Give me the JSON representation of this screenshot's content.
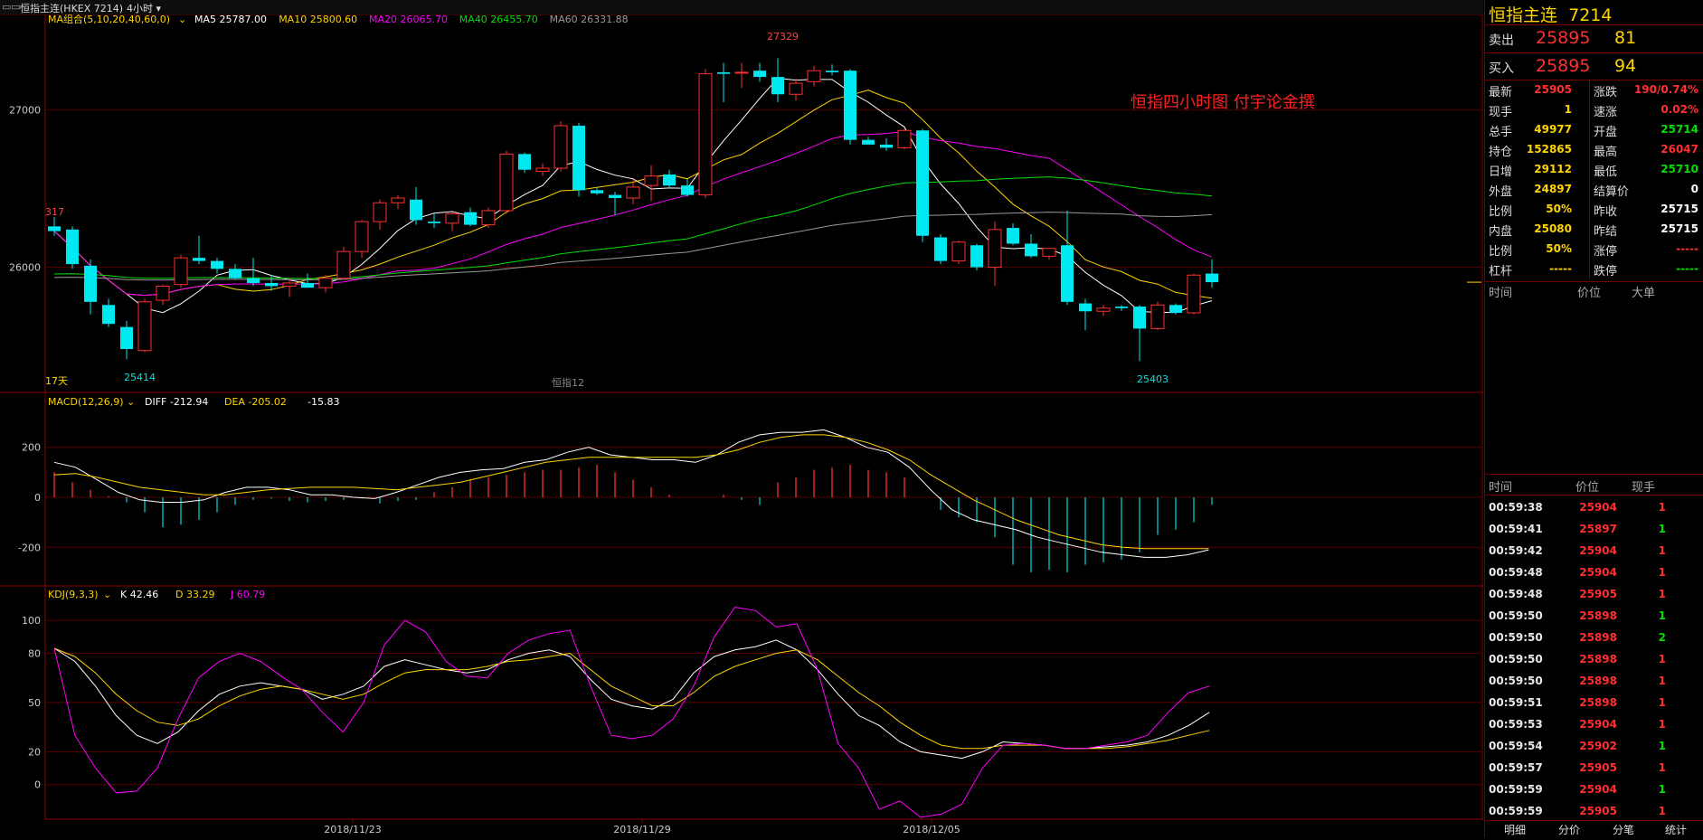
{
  "topbar": {
    "symbol": "恒指主连(HKEX 7214)",
    "period": "4小时",
    "icon": "indicator-icon",
    "menu_icon": "chevron-down-icon"
  },
  "ma_legend": {
    "label": "MA组合(5,10,20,40,60,0)",
    "items": [
      {
        "text": "MA5 25787.00",
        "color": "#ffffff"
      },
      {
        "text": "MA10 25800.60",
        "color": "#ffd400"
      },
      {
        "text": "MA20 26065.70",
        "color": "#ff00ff"
      },
      {
        "text": "MA40 26455.70",
        "color": "#00e000"
      },
      {
        "text": "MA60 26331.88",
        "color": "#999999"
      }
    ]
  },
  "main_annotations": {
    "high_label": "27329",
    "low_left_label": "25414",
    "low_right_label": "25403",
    "left_marker": "317",
    "days_label": "17天",
    "bottom_center": "恒指12",
    "title_text": "恒指四小时图  付宇论金撰"
  },
  "macd_legend": {
    "label": "MACD(12,26,9)",
    "diff": "DIFF -212.94",
    "dea": "DEA -205.02",
    "macd": "-15.83"
  },
  "kdj_legend": {
    "label": "KDJ(9,3,3)",
    "k": "K 42.46",
    "d": "D 33.29",
    "j": "J 60.79"
  },
  "axis_dates": [
    "2018/11/23",
    "2018/11/29",
    "2018/12/05"
  ],
  "chart_data": [
    {
      "type": "candlestick",
      "title": "",
      "yticks": [
        "27000",
        "26000"
      ],
      "ylim": [
        25250,
        27550
      ],
      "candles": [
        {
          "o": 26260,
          "h": 26320,
          "l": 26200,
          "c": 26230
        },
        {
          "o": 26240,
          "h": 26260,
          "l": 25990,
          "c": 26020
        },
        {
          "o": 26010,
          "h": 26050,
          "l": 25700,
          "c": 25780
        },
        {
          "o": 25760,
          "h": 25800,
          "l": 25620,
          "c": 25640
        },
        {
          "o": 25620,
          "h": 25660,
          "l": 25414,
          "c": 25480
        },
        {
          "o": 25470,
          "h": 25800,
          "l": 25460,
          "c": 25780
        },
        {
          "o": 25790,
          "h": 25890,
          "l": 25760,
          "c": 25880
        },
        {
          "o": 25890,
          "h": 26080,
          "l": 25870,
          "c": 26060
        },
        {
          "o": 26060,
          "h": 26200,
          "l": 26020,
          "c": 26040
        },
        {
          "o": 26040,
          "h": 26060,
          "l": 25960,
          "c": 25990
        },
        {
          "o": 25990,
          "h": 26020,
          "l": 25920,
          "c": 25930
        },
        {
          "o": 25930,
          "h": 26060,
          "l": 25880,
          "c": 25900
        },
        {
          "o": 25900,
          "h": 25950,
          "l": 25850,
          "c": 25880
        },
        {
          "o": 25880,
          "h": 25930,
          "l": 25810,
          "c": 25900
        },
        {
          "o": 25900,
          "h": 25960,
          "l": 25880,
          "c": 25870
        },
        {
          "o": 25870,
          "h": 25950,
          "l": 25840,
          "c": 25930
        },
        {
          "o": 25930,
          "h": 26130,
          "l": 25920,
          "c": 26100
        },
        {
          "o": 26100,
          "h": 26300,
          "l": 26060,
          "c": 26290
        },
        {
          "o": 26290,
          "h": 26430,
          "l": 26240,
          "c": 26410
        },
        {
          "o": 26410,
          "h": 26460,
          "l": 26370,
          "c": 26440
        },
        {
          "o": 26430,
          "h": 26510,
          "l": 26270,
          "c": 26300
        },
        {
          "o": 26290,
          "h": 26340,
          "l": 26250,
          "c": 26280
        },
        {
          "o": 26280,
          "h": 26350,
          "l": 26230,
          "c": 26340
        },
        {
          "o": 26350,
          "h": 26380,
          "l": 26260,
          "c": 26270
        },
        {
          "o": 26270,
          "h": 26380,
          "l": 26250,
          "c": 26360
        },
        {
          "o": 26360,
          "h": 26740,
          "l": 26340,
          "c": 26720
        },
        {
          "o": 26720,
          "h": 26730,
          "l": 26600,
          "c": 26620
        },
        {
          "o": 26610,
          "h": 26660,
          "l": 26580,
          "c": 26630
        },
        {
          "o": 26630,
          "h": 26930,
          "l": 26610,
          "c": 26900
        },
        {
          "o": 26900,
          "h": 26920,
          "l": 26450,
          "c": 26490
        },
        {
          "o": 26490,
          "h": 26510,
          "l": 26460,
          "c": 26470
        },
        {
          "o": 26460,
          "h": 26480,
          "l": 26330,
          "c": 26440
        },
        {
          "o": 26440,
          "h": 26560,
          "l": 26400,
          "c": 26510
        },
        {
          "o": 26520,
          "h": 26650,
          "l": 26420,
          "c": 26580
        },
        {
          "o": 26590,
          "h": 26620,
          "l": 26500,
          "c": 26520
        },
        {
          "o": 26520,
          "h": 26560,
          "l": 26450,
          "c": 26460
        },
        {
          "o": 26460,
          "h": 27260,
          "l": 26440,
          "c": 27230
        },
        {
          "o": 27240,
          "h": 27300,
          "l": 27050,
          "c": 27230
        },
        {
          "o": 27240,
          "h": 27300,
          "l": 27140,
          "c": 27240
        },
        {
          "o": 27250,
          "h": 27300,
          "l": 27180,
          "c": 27210
        },
        {
          "o": 27210,
          "h": 27329,
          "l": 27050,
          "c": 27100
        },
        {
          "o": 27100,
          "h": 27200,
          "l": 27060,
          "c": 27170
        },
        {
          "o": 27180,
          "h": 27280,
          "l": 27150,
          "c": 27250
        },
        {
          "o": 27250,
          "h": 27290,
          "l": 27220,
          "c": 27240
        },
        {
          "o": 27250,
          "h": 27260,
          "l": 26780,
          "c": 26810
        },
        {
          "o": 26810,
          "h": 26830,
          "l": 26780,
          "c": 26780
        },
        {
          "o": 26780,
          "h": 26820,
          "l": 26740,
          "c": 26760
        },
        {
          "o": 26760,
          "h": 26880,
          "l": 26750,
          "c": 26870
        },
        {
          "o": 26870,
          "h": 26880,
          "l": 26160,
          "c": 26200
        },
        {
          "o": 26190,
          "h": 26210,
          "l": 26020,
          "c": 26040
        },
        {
          "o": 26040,
          "h": 26170,
          "l": 26020,
          "c": 26160
        },
        {
          "o": 26140,
          "h": 26150,
          "l": 25980,
          "c": 26000
        },
        {
          "o": 26000,
          "h": 26290,
          "l": 25880,
          "c": 26240
        },
        {
          "o": 26250,
          "h": 26280,
          "l": 26140,
          "c": 26150
        },
        {
          "o": 26150,
          "h": 26210,
          "l": 26060,
          "c": 26070
        },
        {
          "o": 26070,
          "h": 26120,
          "l": 26050,
          "c": 26120
        },
        {
          "o": 26140,
          "h": 26360,
          "l": 25760,
          "c": 25780
        },
        {
          "o": 25770,
          "h": 25800,
          "l": 25600,
          "c": 25720
        },
        {
          "o": 25720,
          "h": 25760,
          "l": 25690,
          "c": 25740
        },
        {
          "o": 25750,
          "h": 25760,
          "l": 25720,
          "c": 25740
        },
        {
          "o": 25750,
          "h": 25760,
          "l": 25403,
          "c": 25610
        },
        {
          "o": 25610,
          "h": 25780,
          "l": 25600,
          "c": 25760
        },
        {
          "o": 25760,
          "h": 25770,
          "l": 25700,
          "c": 25710
        },
        {
          "o": 25710,
          "h": 25960,
          "l": 25700,
          "c": 25950
        },
        {
          "o": 25960,
          "h": 26050,
          "l": 25870,
          "c": 25905
        }
      ]
    },
    {
      "type": "bar",
      "title": "MACD",
      "yticks": [
        "200",
        "0",
        "-200"
      ],
      "ylim": [
        -340,
        340
      ],
      "macd_hist": [
        100,
        60,
        30,
        5,
        -20,
        -60,
        -120,
        -110,
        -90,
        -60,
        -30,
        -10,
        -5,
        -15,
        -20,
        -15,
        -10,
        -5,
        -25,
        -15,
        -10,
        20,
        40,
        70,
        80,
        90,
        100,
        110,
        110,
        120,
        130,
        100,
        70,
        40,
        10,
        0,
        0,
        10,
        -10,
        -30,
        60,
        80,
        110,
        120,
        130,
        110,
        100,
        80,
        0,
        -50,
        -80,
        -100,
        -160,
        -270,
        -300,
        -290,
        -300,
        -270,
        -260,
        -250,
        -220,
        -150,
        -130,
        -100,
        -30
      ],
      "diff": [
        140,
        120,
        70,
        20,
        -10,
        -20,
        -20,
        -10,
        20,
        40,
        40,
        30,
        10,
        10,
        0,
        -5,
        20,
        50,
        80,
        100,
        110,
        115,
        140,
        150,
        180,
        200,
        170,
        160,
        150,
        150,
        140,
        170,
        220,
        250,
        260,
        260,
        270,
        240,
        200,
        180,
        120,
        30,
        -50,
        -90,
        -110,
        -130,
        -160,
        -180,
        -200,
        -220,
        -230,
        -240,
        -240,
        -230,
        -210
      ],
      "dea": [
        90,
        95,
        80,
        60,
        40,
        30,
        20,
        10,
        10,
        20,
        30,
        35,
        40,
        40,
        40,
        35,
        30,
        40,
        50,
        60,
        80,
        100,
        120,
        140,
        150,
        160,
        160,
        160,
        160,
        160,
        160,
        170,
        190,
        220,
        240,
        250,
        250,
        240,
        220,
        190,
        150,
        90,
        40,
        -10,
        -50,
        -90,
        -120,
        -150,
        -170,
        -190,
        -200,
        -205,
        -205,
        -205,
        -205
      ]
    },
    {
      "type": "line",
      "title": "KDJ",
      "yticks": [
        "100",
        "80",
        "50",
        "20",
        "0"
      ],
      "ylim": [
        -20,
        110
      ],
      "k": [
        83,
        75,
        60,
        42,
        30,
        25,
        32,
        45,
        55,
        60,
        62,
        60,
        58,
        52,
        55,
        60,
        72,
        76,
        73,
        70,
        68,
        70,
        76,
        80,
        82,
        78,
        64,
        52,
        48,
        46,
        52,
        68,
        78,
        82,
        84,
        88,
        82,
        70,
        55,
        42,
        36,
        26,
        20,
        18,
        16,
        20,
        26,
        25,
        24,
        22,
        22,
        23,
        24,
        26,
        30,
        36,
        44
      ],
      "d": [
        83,
        78,
        68,
        55,
        45,
        38,
        36,
        40,
        48,
        54,
        58,
        60,
        58,
        55,
        52,
        55,
        62,
        68,
        70,
        70,
        70,
        72,
        75,
        76,
        78,
        80,
        70,
        60,
        54,
        48,
        48,
        56,
        66,
        72,
        76,
        80,
        82,
        76,
        66,
        56,
        48,
        38,
        30,
        24,
        22,
        22,
        24,
        24,
        24,
        22,
        22,
        22,
        23,
        25,
        27,
        30,
        33
      ],
      "j": [
        83,
        30,
        10,
        -5,
        -4,
        10,
        40,
        65,
        75,
        80,
        75,
        66,
        58,
        44,
        32,
        50,
        85,
        100,
        93,
        75,
        66,
        65,
        80,
        88,
        92,
        94,
        60,
        30,
        28,
        30,
        40,
        60,
        90,
        108,
        106,
        96,
        98,
        70,
        25,
        10,
        -15,
        -10,
        -20,
        -18,
        -12,
        10,
        24,
        25,
        24,
        22,
        22,
        24,
        26,
        30,
        44,
        56,
        60
      ]
    }
  ],
  "side": {
    "title": "恒指主连",
    "code": "7214",
    "sell": {
      "label": "卖出",
      "price": "25895",
      "vol": "81"
    },
    "buy": {
      "label": "买入",
      "price": "25895",
      "vol": "94"
    },
    "stats": [
      {
        "l": "最新",
        "v": "25905",
        "vc": "#ff3030",
        "l2": "涨跌",
        "v2": "190/0.74%",
        "v2c": "#ff3030"
      },
      {
        "l": "现手",
        "v": "1",
        "vc": "#ffd400",
        "l2": "速涨",
        "v2": "0.02%",
        "v2c": "#ff3030"
      },
      {
        "l": "总手",
        "v": "49977",
        "vc": "#ffd400",
        "l2": "开盘",
        "v2": "25714",
        "v2c": "#00e000"
      },
      {
        "l": "持仓",
        "v": "152865",
        "vc": "#ffd400",
        "l2": "最高",
        "v2": "26047",
        "v2c": "#ff3030"
      },
      {
        "l": "日增",
        "v": "29112",
        "vc": "#ffd400",
        "l2": "最低",
        "v2": "25710",
        "v2c": "#00e000"
      },
      {
        "l": "外盘",
        "v": "24897",
        "vc": "#ffd400",
        "l2": "结算价",
        "v2": "0",
        "v2c": "#ffffff"
      },
      {
        "l": "比例",
        "v": "50%",
        "vc": "#ffd400",
        "l2": "昨收",
        "v2": "25715",
        "v2c": "#ffffff"
      },
      {
        "l": "内盘",
        "v": "25080",
        "vc": "#ffd400",
        "l2": "昨结",
        "v2": "25715",
        "v2c": "#ffffff"
      },
      {
        "l": "比例",
        "v": "50%",
        "vc": "#ffd400",
        "l2": "涨停",
        "v2": "-----",
        "v2c": "#ff3030"
      },
      {
        "l": "杠杆",
        "v": "-----",
        "vc": "#ffd400",
        "l2": "跌停",
        "v2": "-----",
        "v2c": "#00e000"
      }
    ],
    "big_header": {
      "time": "时间",
      "price": "价位",
      "big": "大单"
    },
    "tick_header": {
      "time": "时间",
      "price": "价位",
      "vol": "现手"
    },
    "ticks": [
      {
        "time": "00:59:38",
        "price": "25904",
        "vol": "1",
        "vc": "#ff3030"
      },
      {
        "time": "00:59:41",
        "price": "25897",
        "vol": "1",
        "vc": "#00e000"
      },
      {
        "time": "00:59:42",
        "price": "25904",
        "vol": "1",
        "vc": "#ff3030"
      },
      {
        "time": "00:59:48",
        "price": "25904",
        "vol": "1",
        "vc": "#ff3030"
      },
      {
        "time": "00:59:48",
        "price": "25905",
        "vol": "1",
        "vc": "#ff3030"
      },
      {
        "time": "00:59:50",
        "price": "25898",
        "vol": "1",
        "vc": "#00e000"
      },
      {
        "time": "00:59:50",
        "price": "25898",
        "vol": "2",
        "vc": "#00e000"
      },
      {
        "time": "00:59:50",
        "price": "25898",
        "vol": "1",
        "vc": "#ff3030"
      },
      {
        "time": "00:59:50",
        "price": "25898",
        "vol": "1",
        "vc": "#ff3030"
      },
      {
        "time": "00:59:51",
        "price": "25898",
        "vol": "1",
        "vc": "#ff3030"
      },
      {
        "time": "00:59:53",
        "price": "25904",
        "vol": "1",
        "vc": "#ff3030"
      },
      {
        "time": "00:59:54",
        "price": "25902",
        "vol": "1",
        "vc": "#00e000"
      },
      {
        "time": "00:59:57",
        "price": "25905",
        "vol": "1",
        "vc": "#ff3030"
      },
      {
        "time": "00:59:59",
        "price": "25904",
        "vol": "1",
        "vc": "#00e000"
      },
      {
        "time": "00:59:59",
        "price": "25905",
        "vol": "1",
        "vc": "#ff3030"
      }
    ],
    "tabs": [
      "明细",
      "分价",
      "分笔",
      "统计"
    ]
  }
}
